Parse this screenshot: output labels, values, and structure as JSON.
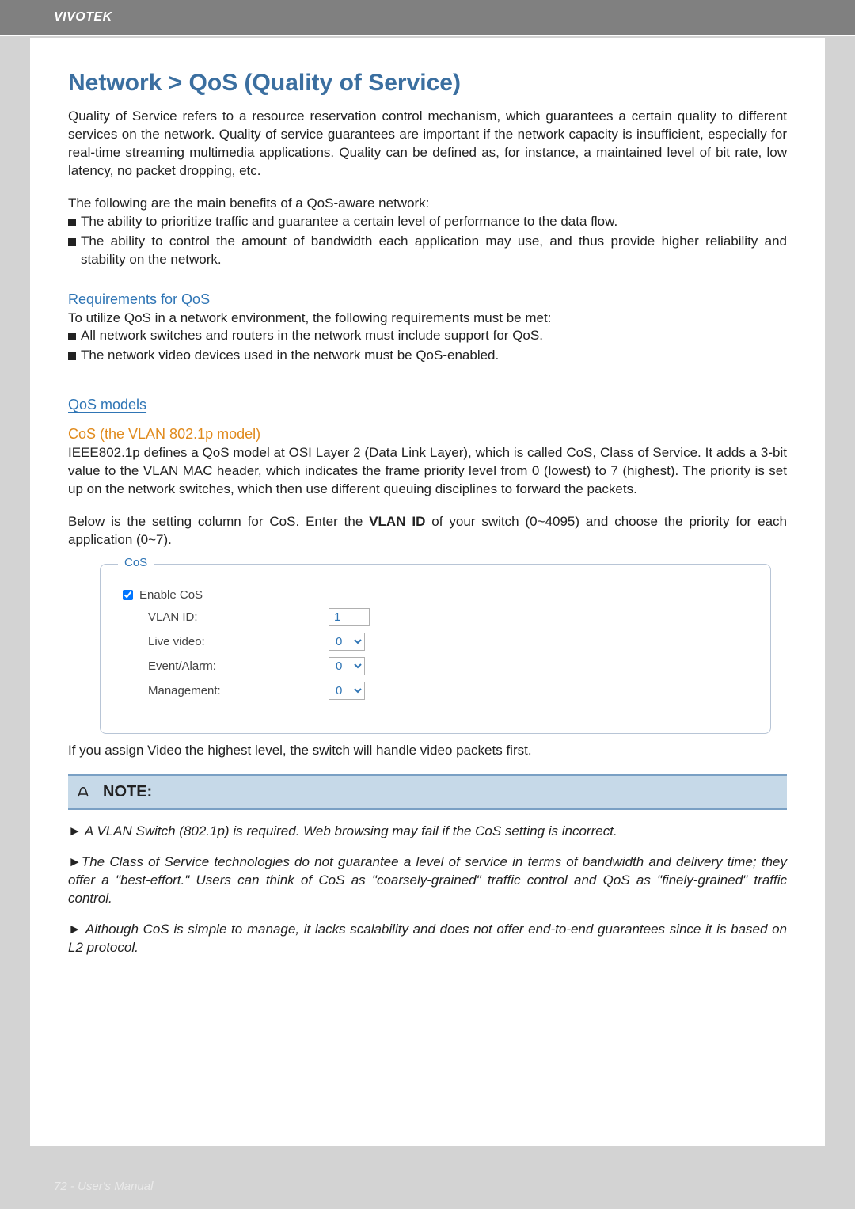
{
  "header": {
    "brand": "VIVOTEK"
  },
  "title": "Network > QoS (Quality of Service)",
  "intro": "Quality of Service refers to a resource reservation control mechanism, which guarantees a certain quality to different services on the network. Quality of service guarantees are important if the network capacity is insufficient, especially for real-time streaming multimedia applications. Quality can be defined as, for instance, a maintained level of bit rate, low latency, no packet dropping, etc.",
  "benefits_intro": "The following are the main benefits of a QoS-aware network:",
  "benefits": [
    "The ability to prioritize traffic and guarantee a certain level of performance to the data flow.",
    "The ability to control the amount of bandwidth each application may use, and thus provide higher reliability and stability on the network."
  ],
  "req_heading": "Requirements for QoS",
  "req_intro": "To utilize QoS in a network environment, the following requirements must be met:",
  "reqs": [
    "All network switches and routers in the network must include support for QoS.",
    "The network video devices used in the network must be QoS-enabled."
  ],
  "models_heading": "QoS models",
  "cos_heading": "CoS (the VLAN 802.1p model)",
  "cos_para": "IEEE802.1p defines a QoS model at OSI Layer 2 (Data Link Layer), which is called CoS, Class of Service. It adds a 3-bit value to the VLAN MAC header, which indicates the frame priority level from 0 (lowest) to 7 (highest). The priority is set up on the network switches, which then use different queuing disciplines to forward the packets.",
  "cos_setting_pre": "Below is the setting column for CoS. Enter the ",
  "cos_setting_bold": "VLAN ID",
  "cos_setting_post": " of your switch (0~4095) and choose the priority for each application (0~7).",
  "cos_panel": {
    "legend": "CoS",
    "enable_label": "Enable CoS",
    "enable_checked": true,
    "rows": [
      {
        "label": "VLAN ID:",
        "type": "text",
        "value": "1"
      },
      {
        "label": "Live video:",
        "type": "select",
        "value": "0"
      },
      {
        "label": "Event/Alarm:",
        "type": "select",
        "value": "0"
      },
      {
        "label": "Management:",
        "type": "select",
        "value": "0"
      }
    ]
  },
  "after_panel": "If you assign Video the highest level, the switch will handle video packets first.",
  "note_title": "NOTE:",
  "notes": [
    "A VLAN Switch (802.1p) is required. Web browsing may fail if the CoS setting is incorrect.",
    "The Class of Service technologies do not guarantee a level of service in terms of bandwidth and delivery time; they offer a \"best-effort.\" Users can think of CoS as \"coarsely-grained\" traffic control and QoS as \"finely-grained\" traffic control.",
    "Although CoS is simple to manage, it lacks scalability and does not offer end-to-end guarantees since it is based on L2 protocol."
  ],
  "footer": "72 - User's Manual"
}
